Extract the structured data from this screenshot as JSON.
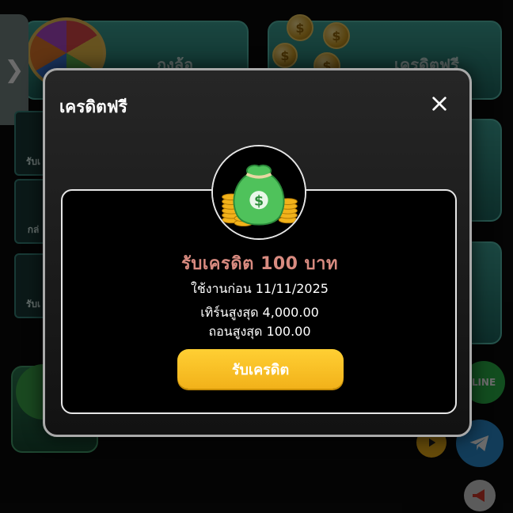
{
  "background": {
    "wheel_tile_label": "กงล้อ",
    "credit_tile_label": "เครดิตฟรี",
    "side_cards": [
      "รับเ",
      "กล่",
      "รับเ"
    ],
    "side_tab_glyph": "❯",
    "line_button_label": "LINE",
    "coin_symbol": "$"
  },
  "modal": {
    "title": "เครดิตฟรี",
    "close_icon": "close-icon",
    "reward_icon": "money-bag-icon",
    "credit_title": "รับเครดิต 100 บาท",
    "use_before": "ใช้งานก่อน 11/11/2025",
    "max_turnover": "เทิร์นสูงสุด 4,000.00",
    "max_withdraw": "ถอนสูงสุด 100.00",
    "claim_button": "รับเครดิต"
  },
  "colors": {
    "accent_gold": "#f5b81c",
    "teal": "#3fa79a",
    "credit_title": "#d98b80"
  }
}
